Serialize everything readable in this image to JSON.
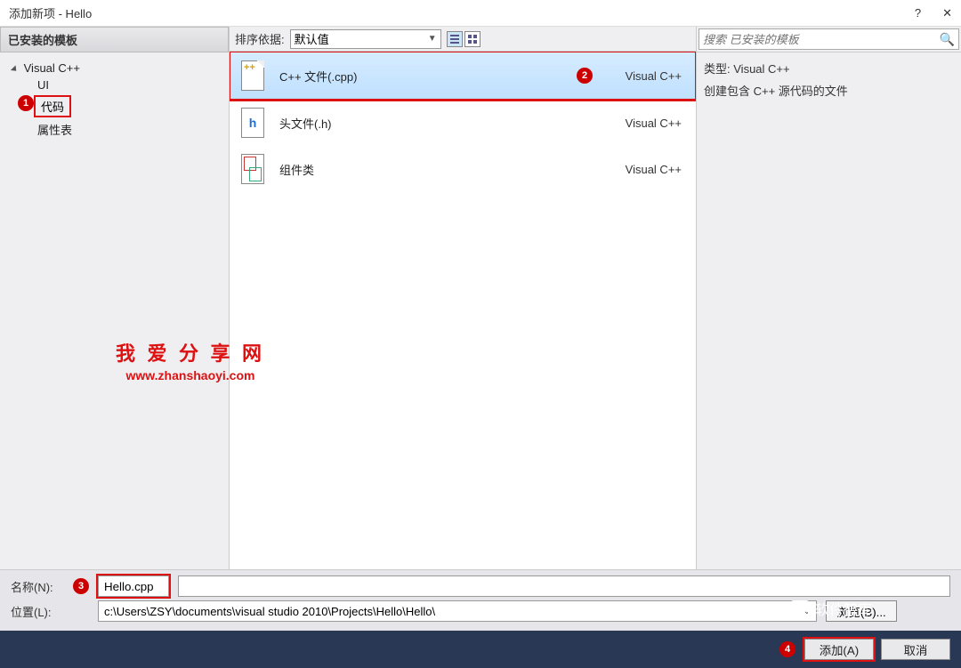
{
  "window": {
    "title": "添加新项 - Hello",
    "help": "?",
    "close": "✕"
  },
  "left": {
    "header": "已安装的模板",
    "root": "Visual C++",
    "children": {
      "ui": "UI",
      "code": "代码",
      "propsheet": "属性表"
    }
  },
  "toolbar": {
    "sort_label": "排序依据:",
    "sort_value": "默认值"
  },
  "templates": {
    "items": [
      {
        "name": "C++ 文件(.cpp)",
        "lang": "Visual C++"
      },
      {
        "name": "头文件(.h)",
        "lang": "Visual C++"
      },
      {
        "name": "组件类",
        "lang": "Visual C++"
      }
    ]
  },
  "search": {
    "placeholder": "搜索 已安装的模板"
  },
  "details": {
    "type_label": "类型:",
    "type_value": "Visual C++",
    "description": "创建包含 C++ 源代码的文件"
  },
  "form": {
    "name_label": "名称(N):",
    "name_value": "Hello.cpp",
    "location_label": "位置(L):",
    "location_value": "c:\\Users\\ZSY\\documents\\visual studio 2010\\Projects\\Hello\\Hello\\",
    "browse": "浏览(B)..."
  },
  "actions": {
    "add": "添加(A)",
    "cancel": "取消"
  },
  "watermark": {
    "line1": "我 爱 分 享 网",
    "line2": "www.zhanshaoyi.com"
  },
  "footer_brand": "软件智库",
  "annotations": {
    "badge1": "1",
    "badge2": "2",
    "badge3": "3",
    "badge4": "4"
  }
}
